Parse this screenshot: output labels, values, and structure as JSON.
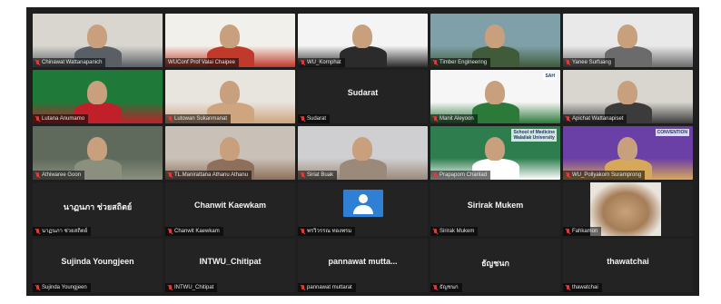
{
  "meeting": {
    "colors": {
      "background": "#1e1e1e",
      "active_speaker": "#9be03c",
      "muted": "#e23a3a"
    },
    "tiles": [
      {
        "row": 1,
        "type": "video",
        "label": "Chinawat Wattanapanich",
        "muted": true,
        "active": true
      },
      {
        "row": 1,
        "type": "video",
        "label": "WUConf Prof Valai Chaipee",
        "muted": false
      },
      {
        "row": 1,
        "type": "video",
        "label": "WU_Kornphat",
        "muted": true,
        "slide_text": "",
        "notes": ""
      },
      {
        "row": 1,
        "type": "video",
        "label": "Timber Engineering",
        "muted": true
      },
      {
        "row": 1,
        "type": "video",
        "label": "Yanee Surfuang",
        "muted": true
      },
      {
        "row": 2,
        "type": "video",
        "label": "Lutana Anumamo",
        "muted": true
      },
      {
        "row": 2,
        "type": "video",
        "label": "Lutowan Sukanmanat",
        "muted": true
      },
      {
        "row": 2,
        "type": "name",
        "center_name": "Sudarat",
        "label": "Sudarat",
        "muted": true
      },
      {
        "row": 2,
        "type": "video",
        "label": "Manit Aleyoon",
        "muted": true,
        "slide_text": "SAH"
      },
      {
        "row": 2,
        "type": "video",
        "label": "Apichat Wattanapiset",
        "muted": true
      },
      {
        "row": 3,
        "type": "video",
        "label": "Athiwaree Goon",
        "muted": true
      },
      {
        "row": 3,
        "type": "video",
        "label": "TL.Manirattana Athanu Athanu",
        "muted": true
      },
      {
        "row": 3,
        "type": "video",
        "label": "Siriat Buak",
        "muted": true
      },
      {
        "row": 3,
        "type": "video",
        "label": "Prapaporn Chanlad",
        "muted": true,
        "slide_text": "School of Medicine\nWalailak University"
      },
      {
        "row": 3,
        "type": "video",
        "label": "WU_Pollyakorn Suramprong",
        "muted": true,
        "slide_text": "CONVENTION"
      },
      {
        "row": 4,
        "type": "name",
        "center_name": "นาฏนภา ช่วยสถิตย์",
        "label": "นาฏนภา ช่วยสถิตย์",
        "muted": true
      },
      {
        "row": 4,
        "type": "name",
        "center_name": "Chanwit Kaewkam",
        "label": "Chanwit Kaewkam",
        "muted": true
      },
      {
        "row": 4,
        "type": "avatar",
        "label": "พรวิวรรณ ทองพรม",
        "muted": true
      },
      {
        "row": 4,
        "type": "name",
        "center_name": "Sirirak Mukem",
        "label": "Sirirak Mukem",
        "muted": true
      },
      {
        "row": 4,
        "type": "cat",
        "label": "Fahkamon",
        "muted": true
      },
      {
        "row": 5,
        "type": "name",
        "center_name": "Sujinda Youngjeen",
        "label": "Sujinda Youngjeen",
        "muted": true
      },
      {
        "row": 5,
        "type": "name",
        "center_name": "INTWU_Chitipat",
        "label": "INTWU_Chitipat",
        "muted": true
      },
      {
        "row": 5,
        "type": "name",
        "center_name": "pannawat  mutta...",
        "label": "pannawat muttarat",
        "muted": true
      },
      {
        "row": 5,
        "type": "name",
        "center_name": "ธัญชนก",
        "label": "ธัญชนก",
        "muted": true
      },
      {
        "row": 5,
        "type": "name",
        "center_name": "thawatchai",
        "label": "thawatchai",
        "muted": true
      }
    ]
  }
}
